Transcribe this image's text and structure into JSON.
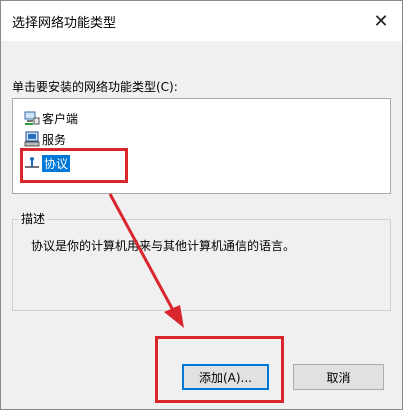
{
  "dialog": {
    "title": "选择网络功能类型",
    "close_glyph": "✕",
    "prompt": "单击要安装的网络功能类型(C):",
    "items": [
      {
        "label": "客户端",
        "icon": "client-icon"
      },
      {
        "label": "服务",
        "icon": "service-icon"
      },
      {
        "label": "协议",
        "icon": "protocol-icon",
        "selected": true
      }
    ],
    "description_title": "描述",
    "description": "协议是你的计算机用来与其他计算机通信的语言。",
    "add_button": "添加(A)...",
    "cancel_button": "取消"
  },
  "colors": {
    "selection": "#0078d7",
    "annotation": "#d9262c"
  }
}
